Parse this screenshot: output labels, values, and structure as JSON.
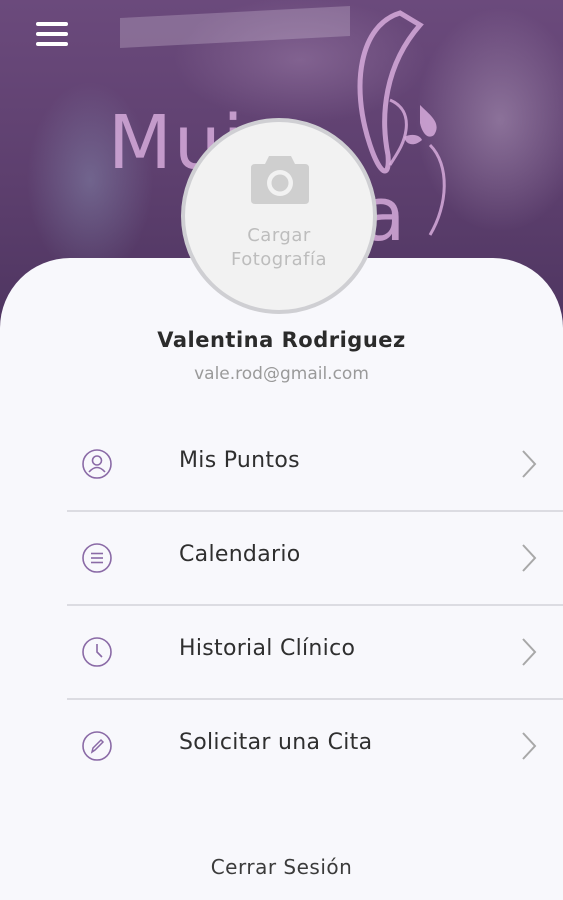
{
  "header": {
    "background_image": "clinic-photo-with-logo",
    "brand_text_left": "Mui",
    "brand_text_right": "a",
    "menu_icon": "hamburger-menu-icon"
  },
  "profile": {
    "upload_label_line1": "Cargar",
    "upload_label_line2": "Fotografía",
    "name": "Valentina Rodriguez",
    "email": "vale.rod@gmail.com"
  },
  "menu": {
    "items": [
      {
        "label": "Mis Puntos",
        "icon": "user-circle-icon"
      },
      {
        "label": "Calendario",
        "icon": "list-circle-icon"
      },
      {
        "label": "Historial Clínico",
        "icon": "clock-icon"
      },
      {
        "label": "Solicitar una Cita",
        "icon": "pencil-circle-icon"
      }
    ]
  },
  "footer": {
    "logout_label": "Cerrar Sesión"
  },
  "colors": {
    "accent": "#8a6aa6",
    "hero": "#5d3f6e",
    "card": "#f8f8fc",
    "divider": "#dcdce2"
  }
}
